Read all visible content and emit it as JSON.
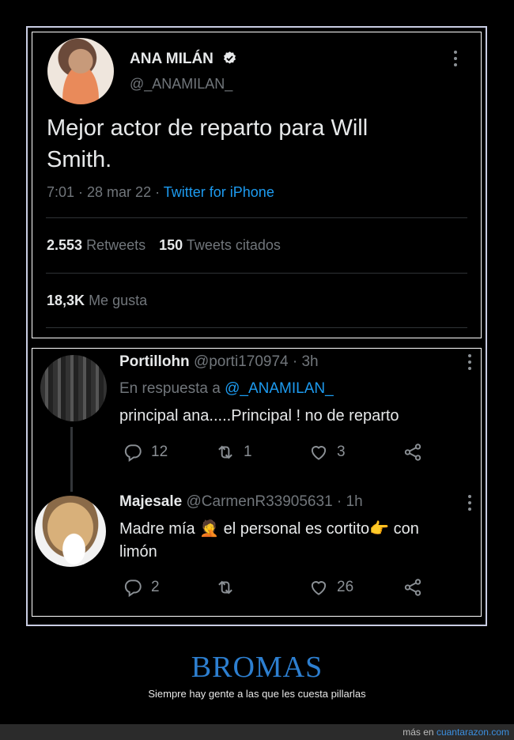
{
  "main_tweet": {
    "author_name": "ANA MILÁN",
    "handle": "@_ANAMILAN_",
    "text_line1": "Mejor actor de reparto para Will",
    "text_line2": "Smith.",
    "timestamp": "7:01 · 28 mar 22 ·",
    "source": "Twitter for iPhone",
    "retweets_count": "2.553",
    "retweets_label": "Retweets",
    "quotes_count": "150",
    "quotes_label": "Tweets citados",
    "likes_count": "18,3K",
    "likes_label": "Me gusta"
  },
  "replies": [
    {
      "author_name": "Portillohn",
      "handle_time": "@porti170974 · 3h",
      "reply_to_label": "En respuesta a",
      "reply_to_handle": "@_ANAMILAN_",
      "text": "principal ana.....Principal ! no de reparto",
      "reply_count": "12",
      "retweet_count": "1",
      "like_count": "3"
    },
    {
      "author_name": "Majesale",
      "handle_time": "@CarmenR33905631 · 1h",
      "text_line1": "Madre mía 🤦 el personal es cortito👉 con",
      "text_line2": "limón",
      "reply_count": "2",
      "retweet_count": "",
      "like_count": "26"
    }
  ],
  "caption": {
    "title": "BROMAS",
    "subtitle": "Siempre hay gente a las que les cuesta pillarlas"
  },
  "footer": {
    "prefix": "más en",
    "site": "cuantarazon.com"
  },
  "colors": {
    "link": "#1d9bf0",
    "caption": "#2d7fd0",
    "muted": "#71767b"
  }
}
